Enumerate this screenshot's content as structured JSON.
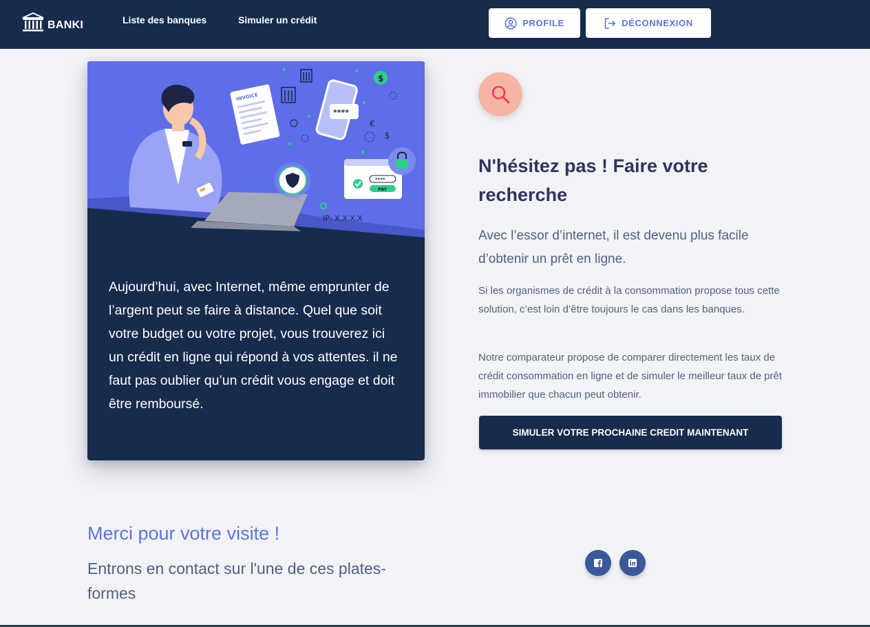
{
  "navbar": {
    "brand": "BANKI",
    "links": [
      "Liste des banques",
      "Simuler un crédit"
    ],
    "profile_label": "PROFILE",
    "logout_label": "DÉCONNEXION"
  },
  "illustration": {
    "invoice_label": "INVOICE",
    "password_mask": "****",
    "card_mask": "****",
    "pay_label": "PAY",
    "ip_label": "IP: X.X.X.X"
  },
  "card": {
    "text": "Aujourd’hui, avec Internet, même emprunter de l’argent peut se faire à distance. Quel que soit votre budget ou votre projet, vous trouverez ici un crédit en ligne qui répond à vos attentes. il ne faut pas oublier qu’un crédit vous engage et doit être remboursé."
  },
  "content": {
    "heading": "N'hésitez pas ! Faire votre recherche",
    "lead": "Avec l’essor d’internet, il est devenu plus facile d’obtenir un prêt en ligne.",
    "paragraph1": "Si les organismes de crédit à la consommation propose tous cette solution, c’est loin d’être toujours le cas dans les banques.",
    "paragraph2": "Notre comparateur propose de comparer directement les taux de crédit consommation en ligne et de simuler le meilleur taux de prêt immobilier que chacun peut obtenir.",
    "cta_label": "SIMULER VOTRE PROCHAINE CREDIT MAINTENANT"
  },
  "footer": {
    "thanks": "Merci pour votre visite !",
    "contact": "Entrons en contact sur l'une de ces plates-formes"
  },
  "icons": {
    "brand": "bank-icon",
    "profile": "user-circle-icon",
    "logout": "logout-icon",
    "search": "search-icon",
    "facebook": "facebook-icon",
    "linkedin": "linkedin-icon"
  },
  "colors": {
    "navbar": "#172b4d",
    "accent": "#5e72e4",
    "search_circle": "#f8b4a2",
    "social": "#3b5999"
  }
}
